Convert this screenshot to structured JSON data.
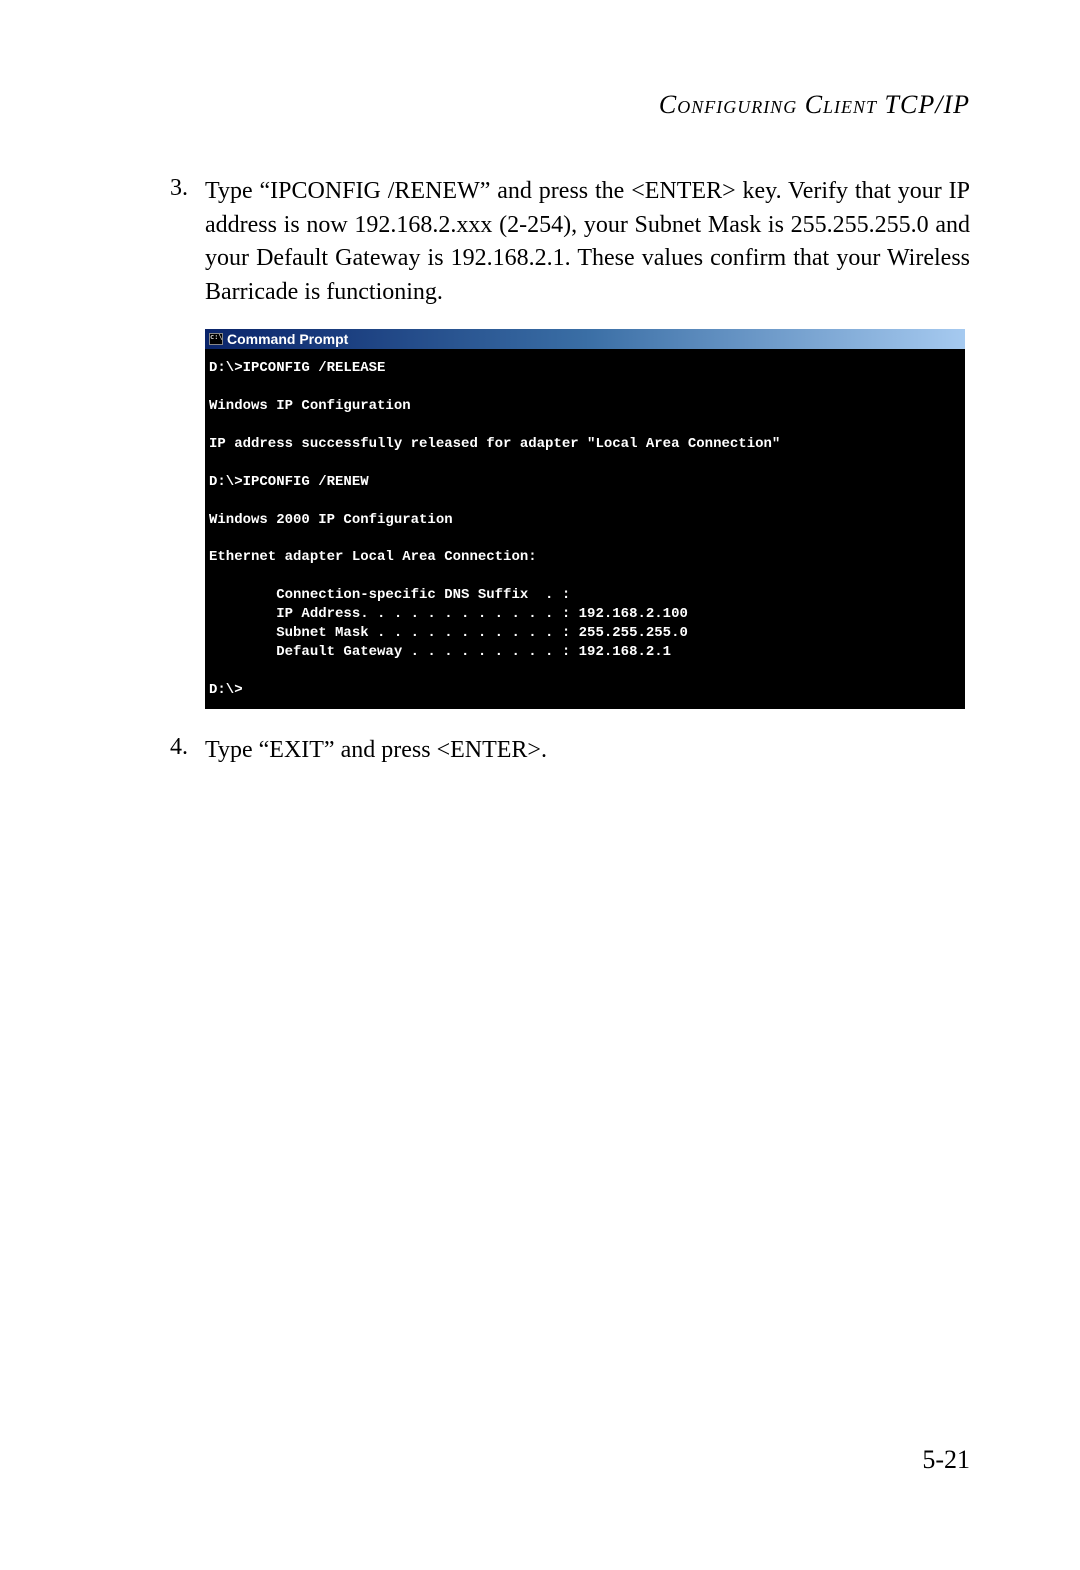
{
  "header": {
    "title": "Configuring Client TCP/IP"
  },
  "steps": [
    {
      "num": "3.",
      "text": "Type “IPCONFIG /RENEW” and press the <ENTER> key. Verify that your IP address is now 192.168.2.xxx (2-254), your Subnet Mask is 255.255.255.0 and your Default Gateway is 192.168.2.1. These values confirm that your Wireless Barricade is functioning."
    },
    {
      "num": "4.",
      "text": "Type “EXIT” and press <ENTER>."
    }
  ],
  "cmd": {
    "title": "Command Prompt",
    "lines": "D:\\>IPCONFIG /RELEASE\n\nWindows IP Configuration\n\nIP address successfully released for adapter \"Local Area Connection\"\n\nD:\\>IPCONFIG /RENEW\n\nWindows 2000 IP Configuration\n\nEthernet adapter Local Area Connection:\n\n        Connection-specific DNS Suffix  . :\n        IP Address. . . . . . . . . . . . : 192.168.2.100\n        Subnet Mask . . . . . . . . . . . : 255.255.255.0\n        Default Gateway . . . . . . . . . : 192.168.2.1\n\nD:\\>"
  },
  "footer": {
    "page_number": "5-21"
  }
}
